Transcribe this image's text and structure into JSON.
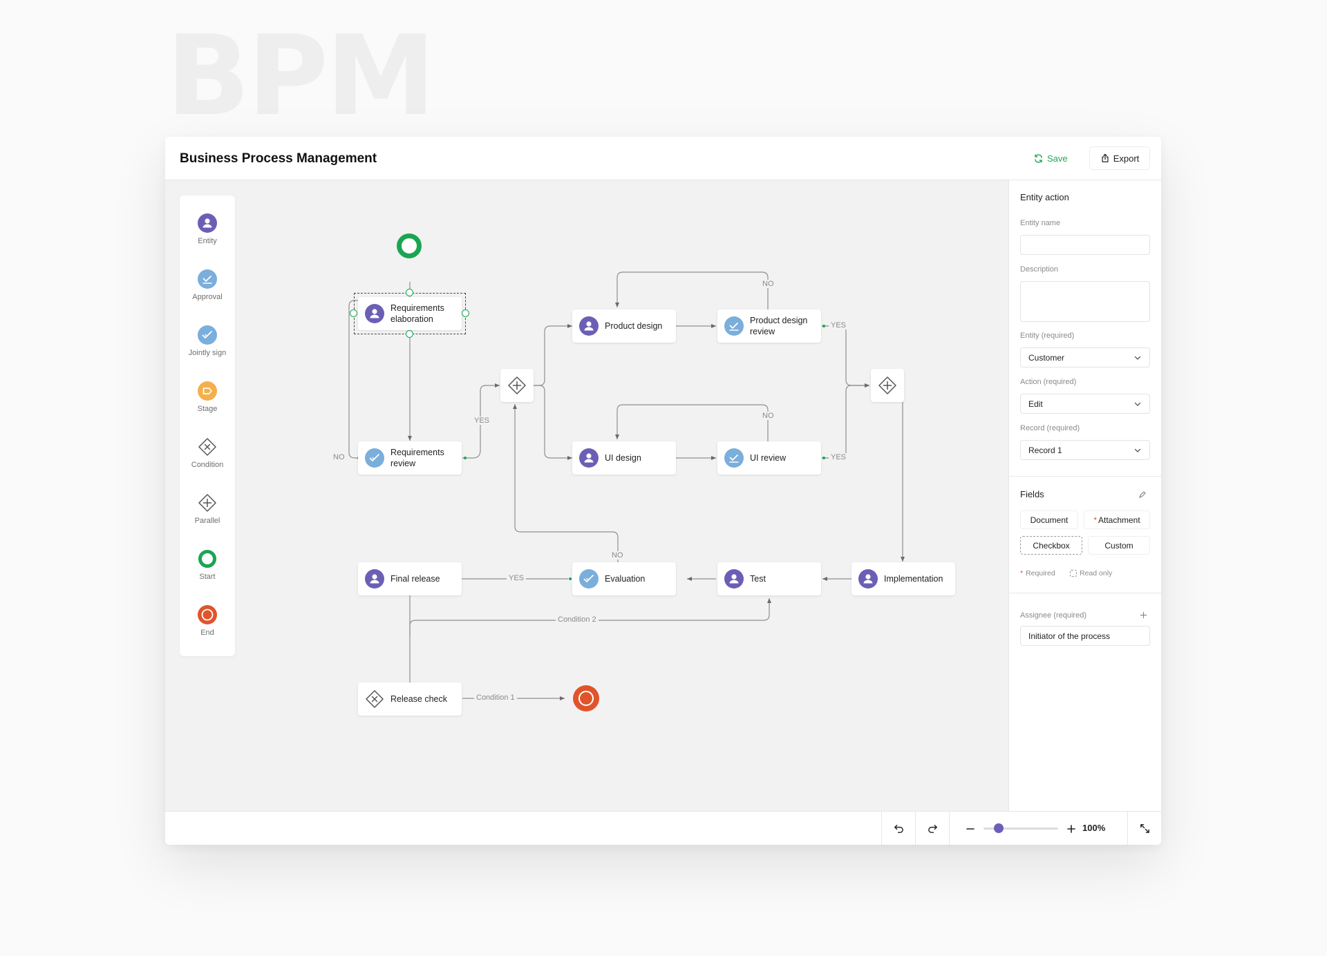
{
  "background_word": "BPM",
  "header": {
    "title": "Business Process Management",
    "save_label": "Save",
    "export_label": "Export"
  },
  "colors": {
    "entity": "#6b5fb5",
    "approval": "#7aaedb",
    "stage": "#f3b04c",
    "start": "#1ba552",
    "end": "#e0542c",
    "save": "#23a455"
  },
  "palette": [
    {
      "label": "Entity",
      "icon": "user-circle-icon"
    },
    {
      "label": "Approval",
      "icon": "approval-check-icon"
    },
    {
      "label": "Jointly sign",
      "icon": "double-check-icon"
    },
    {
      "label": "Stage",
      "icon": "tag-icon"
    },
    {
      "label": "Condition",
      "icon": "condition-diamond-icon"
    },
    {
      "label": "Parallel",
      "icon": "parallel-diamond-icon"
    },
    {
      "label": "Start",
      "icon": "start-circle-icon"
    },
    {
      "label": "End",
      "icon": "end-circle-icon"
    }
  ],
  "nodes": {
    "requirements_elaboration": "Requirements elaboration",
    "requirements_review": "Requirements review",
    "product_design": "Product design",
    "product_design_review": "Product design review",
    "ui_design": "UI design",
    "ui_review": "UI review",
    "implementation": "Implementation",
    "test": "Test",
    "evaluation": "Evaluation",
    "final_release": "Final release",
    "release_check": "Release check"
  },
  "edge_labels": {
    "no_req": "NO",
    "yes_req": "YES",
    "no_pd": "NO",
    "yes_pd": "YES",
    "no_ui": "NO",
    "yes_ui": "YES",
    "no_eval": "NO",
    "yes_eval": "YES",
    "condition2": "Condition 2",
    "condition1": "Condition 1"
  },
  "panel": {
    "title": "Entity action",
    "entity_name_label": "Entity name",
    "entity_name_value": "",
    "description_label": "Description",
    "description_value": "",
    "entity_label": "Entity (required)",
    "entity_value": "Customer",
    "action_label": "Action (required)",
    "action_value": "Edit",
    "record_label": "Record (required)",
    "record_value": "Record 1",
    "fields_title": "Fields",
    "chips": [
      "Document",
      "Attachment",
      "Checkbox",
      "Custom"
    ],
    "chip_required_mark": "*",
    "legend_required": "Required",
    "legend_readonly": "Read only",
    "assignee_label": "Assignee (required)",
    "assignee_value": "Initiator of the process"
  },
  "footer": {
    "zoom": "100%",
    "zoom_level_percent": 100
  }
}
